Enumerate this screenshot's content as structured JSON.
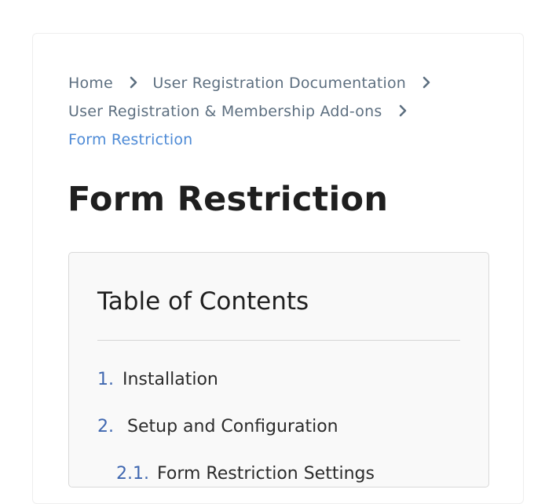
{
  "breadcrumb": {
    "items": [
      {
        "label": "Home"
      },
      {
        "label": "User Registration Documentation"
      },
      {
        "label": "User Registration & Membership Add-ons"
      }
    ],
    "current": "Form Restriction"
  },
  "page": {
    "title": "Form Restriction"
  },
  "toc": {
    "title": "Table of Contents",
    "items": [
      {
        "number": "1.",
        "label": "Installation"
      },
      {
        "number": "2.",
        "label": "Setup and Configuration"
      },
      {
        "number": "2.1.",
        "label": "Form Restriction Settings"
      }
    ]
  },
  "colors": {
    "breadcrumb_link": "#5d6f80",
    "breadcrumb_current": "#4d8ad6",
    "toc_number": "#3f67b0",
    "title": "#1f1f1f"
  }
}
